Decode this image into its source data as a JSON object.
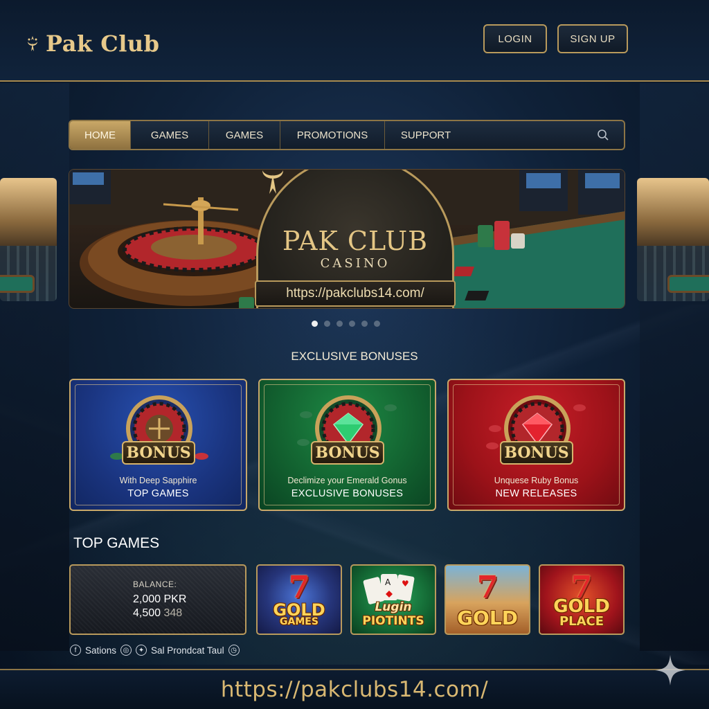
{
  "header": {
    "logo_text": "Pak Club",
    "login_label": "LOGIN",
    "signup_label": "SIGN UP"
  },
  "nav": {
    "items": [
      {
        "label": "HOME",
        "active": true
      },
      {
        "label": "GAMES",
        "active": false
      },
      {
        "label": "GAMES",
        "active": false
      },
      {
        "label": "PROMOTIONS",
        "active": false
      },
      {
        "label": "SUPPORT",
        "active": false
      }
    ],
    "search_icon": "search-icon"
  },
  "hero": {
    "title": "PAK CLUB",
    "subtitle": "CASINO",
    "url": "https://pakclubs14.com/",
    "slide_count": 6,
    "active_slide": 1
  },
  "bonuses": {
    "section_title": "EXCLUSIVE BONUSES",
    "cards": [
      {
        "label": "BONUS",
        "caption": "With Deep Sapphire",
        "subtitle": "TOP GAMES",
        "color": "#1a347f"
      },
      {
        "label": "BONUS",
        "caption": "Declimize your Emerald Gonus",
        "subtitle": "EXCLUSIVE BONUSES",
        "color": "#12602f"
      },
      {
        "label": "BONUS",
        "caption": "Unquese Ruby Bonus",
        "subtitle": "NEW RELEASES",
        "color": "#9c1219"
      }
    ]
  },
  "top_games": {
    "title": "TOP GAMES",
    "balance": {
      "label": "BALANCE:",
      "line1": "2,000 PKR",
      "line2_main": "4,500",
      "line2_dim": "348"
    },
    "games": [
      {
        "seven": "7",
        "name_line1": "GOLD",
        "name_line2": "GAMES"
      },
      {
        "name_line1": "Lugin",
        "name_line2": "PIOTINTS"
      },
      {
        "seven": "7",
        "name_line1": "GOLD",
        "name_line2": ""
      },
      {
        "seven": "7",
        "name_line1": "GOLD",
        "name_line2": "PLACE"
      }
    ]
  },
  "social": {
    "text1": "Sations",
    "text2": "Sal Prondcat Taul",
    "icons": [
      "facebook-icon",
      "instagram-icon",
      "twitter-icon",
      "clock-icon"
    ]
  },
  "footer": {
    "url": "https://pakclubs14.com/"
  },
  "colors": {
    "accent_gold": "#c8a86a",
    "background_navy": "#0f2138"
  }
}
